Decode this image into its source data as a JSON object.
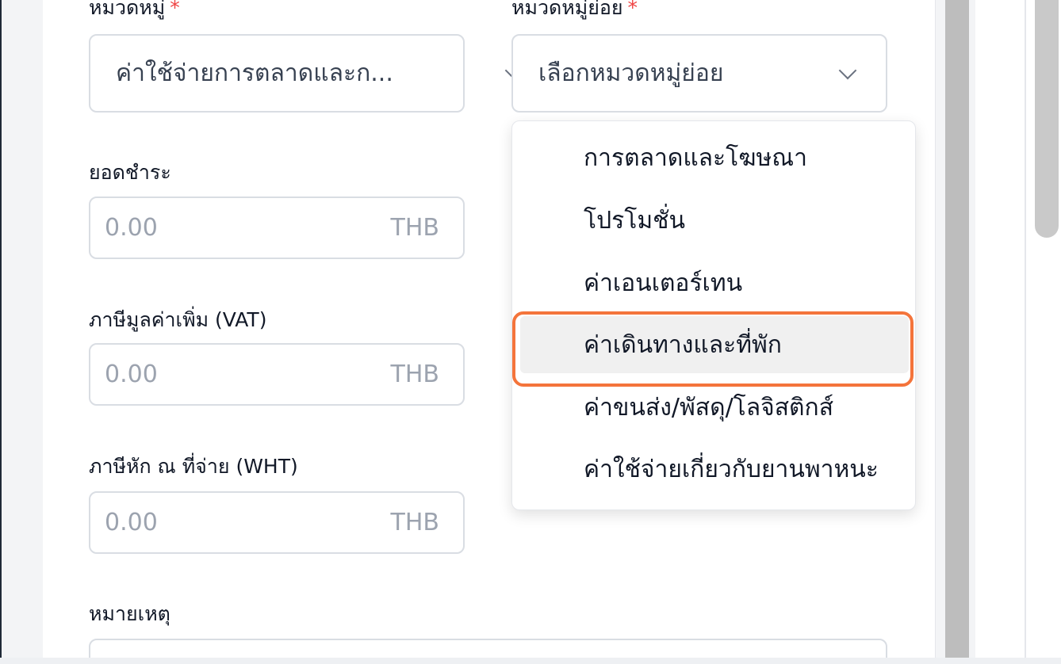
{
  "form": {
    "category": {
      "label": "หมวดหมู่",
      "required_mark": "*",
      "value": "ค่าใช้จ่ายการตลาดและก..."
    },
    "subcategory": {
      "label": "หมวดหมู่ย่อย",
      "required_mark": "*",
      "placeholder": "เลือกหมวดหมู่ย่อย"
    },
    "payment_amount": {
      "label": "ยอดชำระ",
      "placeholder": "0.00",
      "currency": "THB"
    },
    "vat": {
      "label": "ภาษีมูลค่าเพิ่ม (VAT)",
      "placeholder": "0.00",
      "currency": "THB"
    },
    "wht": {
      "label": "ภาษีหัก ณ ที่จ่าย (WHT)",
      "placeholder": "0.00",
      "currency": "THB"
    },
    "notes": {
      "label": "หมายเหตุ"
    }
  },
  "dropdown": {
    "options": [
      {
        "label": "การตลาดและโฆษณา"
      },
      {
        "label": "โปรโมชั่น"
      },
      {
        "label": "ค่าเอนเตอร์เทน"
      },
      {
        "label": "ค่าเดินทางและที่พัก"
      },
      {
        "label": "ค่าขนส่ง/พัสดุ/โลจิสติกส์"
      },
      {
        "label": "ค่าใช้จ่ายเกี่ยวกับยานพาหนะ"
      }
    ],
    "highlighted_index": 3
  },
  "colors": {
    "required": "#ef4444",
    "highlight": "#f4743b",
    "border": "#d9dde3"
  }
}
